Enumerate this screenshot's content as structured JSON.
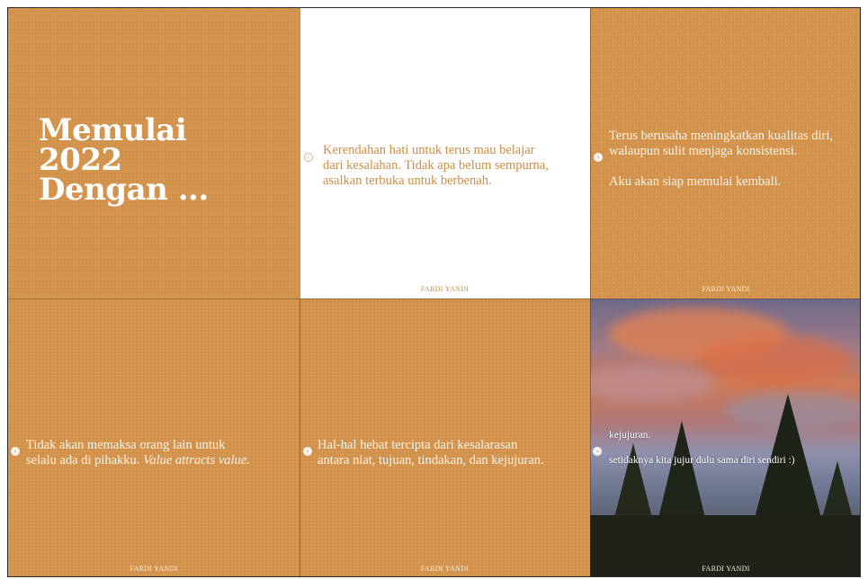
{
  "tiles": [
    {
      "id": "title-tile",
      "title_lines": [
        "Memulai",
        "2022",
        "Dengan ..."
      ]
    },
    {
      "id": "humility-tile",
      "lines": [
        "Kerendahan hati untuk terus mau belajar",
        "dari kesalahan. Tidak apa belum sempurna,",
        "asalkan terbuka untuk berbenah."
      ],
      "footer": "FARDI YANDI"
    },
    {
      "id": "consistency-tile",
      "lines": [
        "Terus berusaha meningkatkan kualitas diri,",
        "walaupun sulit menjaga konsistensi."
      ],
      "lines2": [
        "Aku akan siap memulai kembali."
      ],
      "footer": "FARDI YANDI"
    },
    {
      "id": "value-tile",
      "line1": "Tidak akan memaksa orang lain untuk",
      "line2_plain": "selalu ada di pihakku. ",
      "line2_italic": "Value attracts value.",
      "footer": "FARDI YANDI"
    },
    {
      "id": "harmony-tile",
      "lines": [
        "Hal-hal hebat tercipta dari kesalarasan",
        "antara niat, tujuan, tindakan, dan kejujuran."
      ],
      "footer": "FARDI YANDI"
    },
    {
      "id": "honesty-tile",
      "lines": [
        "kejujuran."
      ],
      "lines2": [
        "setidaknya kita jujur dulu sama diri sendiri :)"
      ],
      "footer": "FARDI YANDI"
    }
  ],
  "colors": {
    "accent": "#d4924a",
    "white": "#ffffff",
    "dark_text_on_white": "#cf8d44"
  }
}
